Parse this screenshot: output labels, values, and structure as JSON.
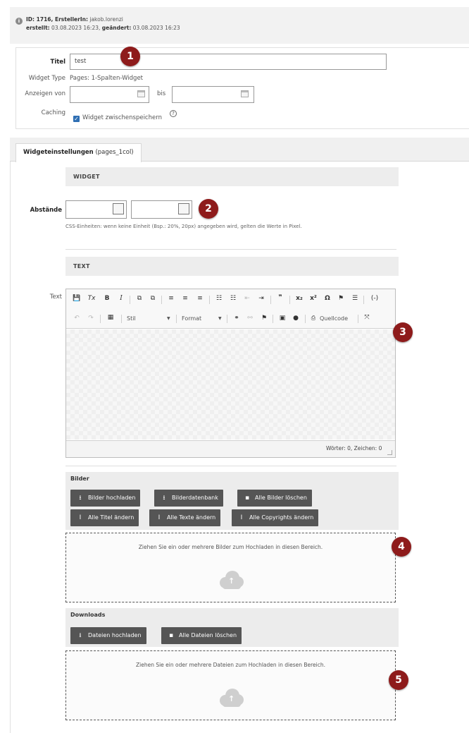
{
  "info": {
    "line1_bold": "ID: 1716, ErstellerIn:",
    "line1_value": "jakob.lorenzi",
    "line2_bold": "erstellt:",
    "line2_created": "03.08.2023 16:23,",
    "line2_bold2": "geändert:",
    "line2_changed": "03.08.2023 16:23"
  },
  "form": {
    "title_label": "Titel",
    "title_value": "test",
    "widget_type_label": "Widget Type",
    "widget_type_value": "Pages: 1-Spalten-Widget",
    "show_from_label": "Anzeigen von",
    "until_label": "bis",
    "caching_label": "Caching",
    "caching_checkbox_label": "Widget zwischenspeichern",
    "caching_checked": true
  },
  "tab": {
    "label_bold": "Widgeteinstellungen",
    "label_suffix": "(pages_1col)"
  },
  "widget_section": {
    "header": "WIDGET",
    "spacing_label": "Abstände",
    "hint": "CSS-Einheiten: wenn keine Einheit (Bsp.: 20%, 20px) angegeben wird, gelten die Werte in Pixel."
  },
  "text_section": {
    "header": "TEXT",
    "field_label": "Text",
    "toolbar_row1": [
      "💾",
      "Tx",
      "B",
      "I",
      "⧉",
      "⧉",
      "≡",
      "≡",
      "≡",
      "☷",
      "☷",
      "⇤",
      "⇥",
      "❞",
      "x₂",
      "x²",
      "Ω",
      "⚑",
      "☰",
      "(-)"
    ],
    "style_label": "Stil",
    "format_label": "Format",
    "source_label": "Quellcode",
    "counter": "Wörter: 0, Zeichen: 0"
  },
  "images": {
    "title": "Bilder",
    "buttons": {
      "upload": "Bilder hochladen",
      "database": "Bilderdatenbank",
      "delete_all": "Alle Bilder löschen",
      "change_titles": "Alle Titel ändern",
      "change_texts": "Alle Texte ändern",
      "change_copyrights": "Alle Copyrights ändern"
    },
    "drop_text": "Ziehen Sie ein oder mehrere Bilder zum Hochladen in diesen Bereich."
  },
  "downloads": {
    "title": "Downloads",
    "buttons": {
      "upload": "Dateien hochladen",
      "delete_all": "Alle Dateien löschen"
    },
    "drop_text": "Ziehen Sie ein oder mehrere Dateien zum Hochladen in diesen Bereich."
  },
  "markers": [
    "1",
    "2",
    "3",
    "4",
    "5"
  ],
  "colors": {
    "marker": "#8e1b1b",
    "button": "#555555",
    "checkbox": "#2f6fb3"
  }
}
